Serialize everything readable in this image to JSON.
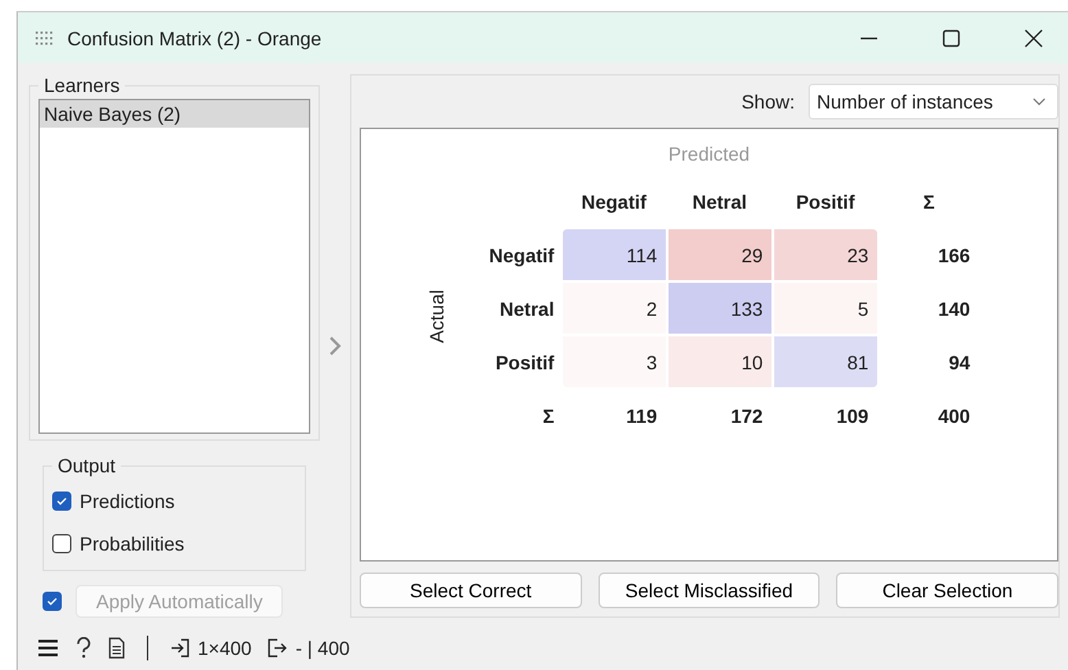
{
  "window": {
    "title": "Confusion Matrix (2) - Orange"
  },
  "learners": {
    "title": "Learners",
    "items": [
      {
        "label": "Naive Bayes (2)",
        "selected": true
      }
    ]
  },
  "output": {
    "title": "Output",
    "options": [
      {
        "label": "Predictions",
        "checked": true
      },
      {
        "label": "Probabilities",
        "checked": false
      }
    ]
  },
  "apply": {
    "checked": true,
    "label": "Apply Automatically",
    "disabled": true
  },
  "show": {
    "label": "Show:",
    "value": "Number of instances"
  },
  "matrix": {
    "predicted_label": "Predicted",
    "actual_label": "Actual",
    "columns": [
      "Negatif",
      "Netral",
      "Positif",
      "Σ"
    ],
    "rows": [
      {
        "label": "Negatif",
        "cells": [
          {
            "value": "114",
            "color": "#d4d4f4"
          },
          {
            "value": "29",
            "color": "#f3cccc"
          },
          {
            "value": "23",
            "color": "#f5d6d6"
          }
        ],
        "total": "166"
      },
      {
        "label": "Netral",
        "cells": [
          {
            "value": "2",
            "color": "#fdf8f7"
          },
          {
            "value": "133",
            "color": "#cdcdf2"
          },
          {
            "value": "5",
            "color": "#fdf5f4"
          }
        ],
        "total": "140"
      },
      {
        "label": "Positif",
        "cells": [
          {
            "value": "3",
            "color": "#fdf8f7"
          },
          {
            "value": "10",
            "color": "#faeaea"
          },
          {
            "value": "81",
            "color": "#dcdcf5"
          }
        ],
        "total": "94"
      }
    ],
    "totals_label": "Σ",
    "totals": [
      "119",
      "172",
      "109",
      "400"
    ]
  },
  "buttons": [
    "Select Correct",
    "Select Misclassified",
    "Clear Selection"
  ],
  "status_bar": {
    "input": "1×400",
    "output": "- | 400"
  }
}
